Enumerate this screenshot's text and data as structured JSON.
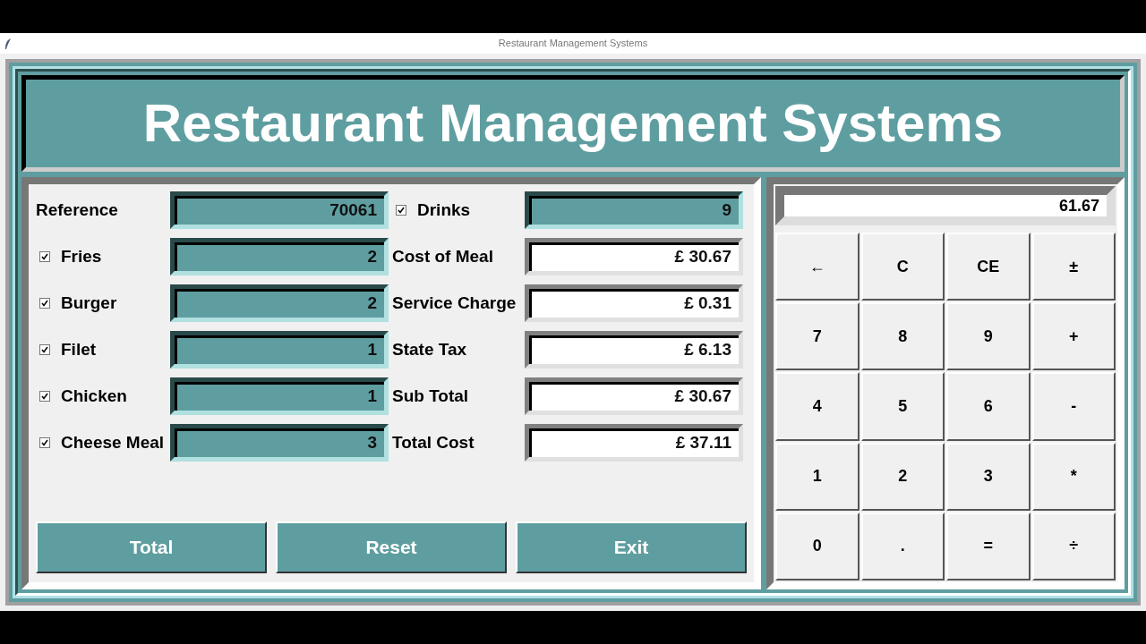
{
  "window": {
    "title": "Restaurant Management Systems"
  },
  "header": {
    "title": "Restaurant Management Systems"
  },
  "left_column": [
    {
      "kind": "label",
      "label": "Reference",
      "value": "70061"
    },
    {
      "kind": "check",
      "label": "Fries",
      "checked": true,
      "value": "2"
    },
    {
      "kind": "check",
      "label": "Burger",
      "checked": true,
      "value": "2"
    },
    {
      "kind": "check",
      "label": "Filet",
      "checked": true,
      "value": "1"
    },
    {
      "kind": "check",
      "label": "Chicken",
      "checked": true,
      "value": "1"
    },
    {
      "kind": "check",
      "label": "Cheese Meal",
      "checked": true,
      "value": "3"
    }
  ],
  "right_column": [
    {
      "kind": "check",
      "label": "Drinks",
      "checked": true,
      "value": "9"
    },
    {
      "kind": "label",
      "label": "Cost of Meal",
      "value": "£ 30.67"
    },
    {
      "kind": "label",
      "label": "Service Charge",
      "value": "£ 0.31"
    },
    {
      "kind": "label",
      "label": "State Tax",
      "value": "£ 6.13"
    },
    {
      "kind": "label",
      "label": "Sub Total",
      "value": "£ 30.67"
    },
    {
      "kind": "label",
      "label": "Total Cost",
      "value": "£ 37.11"
    }
  ],
  "buttons": [
    "Total",
    "Reset",
    "Exit"
  ],
  "calculator": {
    "display": "61.67",
    "keys": [
      "←",
      "C",
      "CE",
      "±",
      "7",
      "8",
      "9",
      "+",
      "4",
      "5",
      "6",
      "-",
      "1",
      "2",
      "3",
      "*",
      "0",
      ".",
      "=",
      "÷"
    ]
  }
}
